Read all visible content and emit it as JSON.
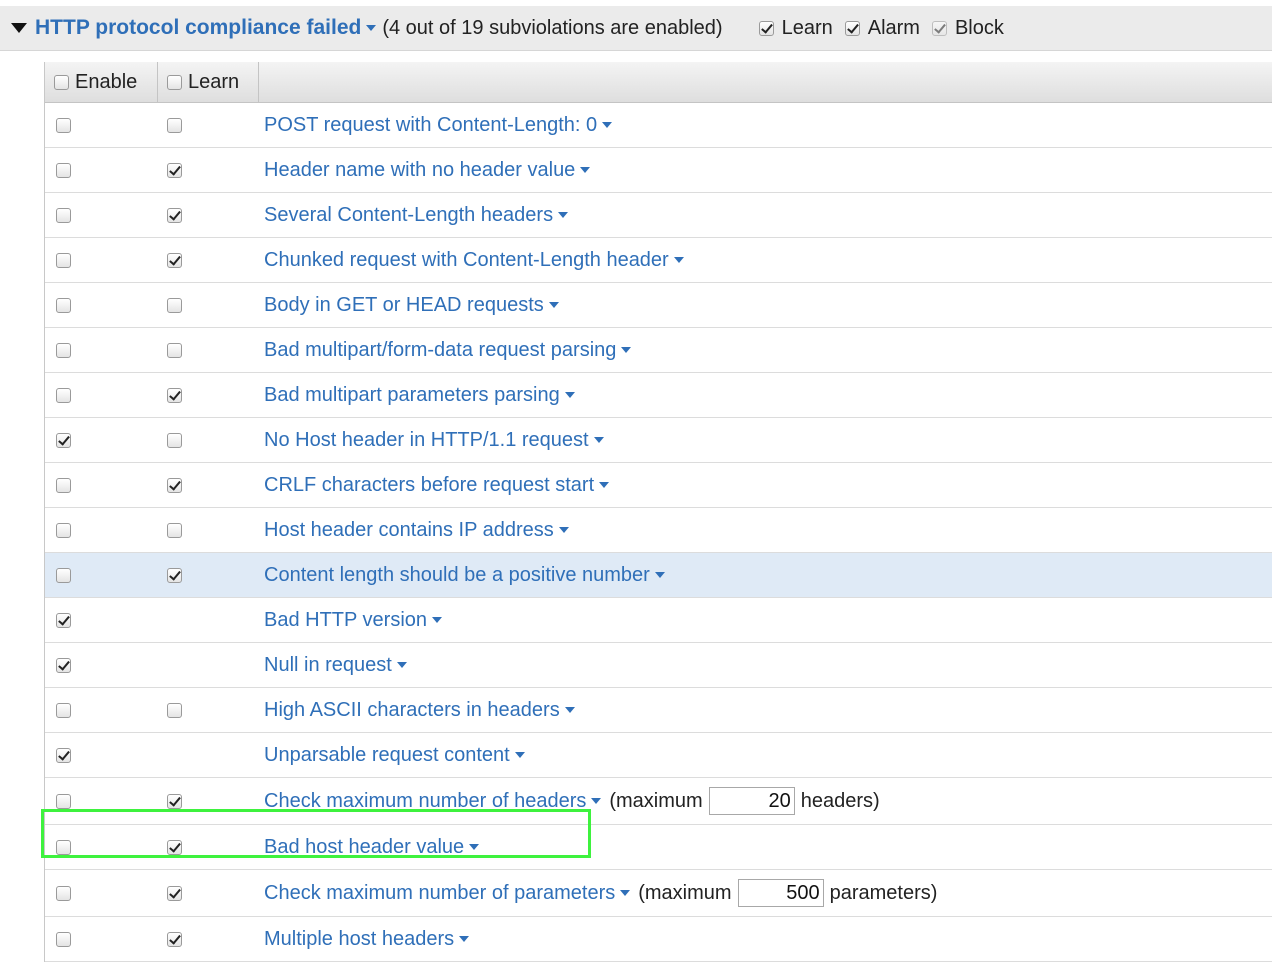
{
  "header": {
    "title": "HTTP protocol compliance failed",
    "summary": "(4 out of 19 subviolations are enabled)",
    "options": [
      {
        "label": "Learn",
        "checked": true,
        "disabled": false
      },
      {
        "label": "Alarm",
        "checked": true,
        "disabled": false
      },
      {
        "label": "Block",
        "checked": true,
        "disabled": true
      }
    ]
  },
  "table": {
    "columns": {
      "enable": "Enable",
      "learn": "Learn"
    },
    "rows": [
      {
        "name": "POST request with Content-Length: 0",
        "enable": false,
        "learn": false
      },
      {
        "name": "Header name with no header value",
        "enable": false,
        "learn": true
      },
      {
        "name": "Several Content-Length headers",
        "enable": false,
        "learn": true
      },
      {
        "name": "Chunked request with Content-Length header",
        "enable": false,
        "learn": true
      },
      {
        "name": "Body in GET or HEAD requests",
        "enable": false,
        "learn": false
      },
      {
        "name": "Bad multipart/form-data request parsing",
        "enable": false,
        "learn": false
      },
      {
        "name": "Bad multipart parameters parsing",
        "enable": false,
        "learn": true
      },
      {
        "name": "No Host header in HTTP/1.1 request",
        "enable": true,
        "learn": false
      },
      {
        "name": "CRLF characters before request start",
        "enable": false,
        "learn": true
      },
      {
        "name": "Host header contains IP address",
        "enable": false,
        "learn": false
      },
      {
        "name": "Content length should be a positive number",
        "enable": false,
        "learn": true,
        "highlighted": true
      },
      {
        "name": "Bad HTTP version",
        "enable": true,
        "learn": null
      },
      {
        "name": "Null in request",
        "enable": true,
        "learn": null
      },
      {
        "name": "High ASCII characters in headers",
        "enable": false,
        "learn": false
      },
      {
        "name": "Unparsable request content",
        "enable": true,
        "learn": null
      },
      {
        "name": "Check maximum number of headers",
        "enable": false,
        "learn": true,
        "prefix": "(maximum",
        "value": "20",
        "suffix": "headers)"
      },
      {
        "name": "Bad host header value",
        "enable": false,
        "learn": true
      },
      {
        "name": "Check maximum number of parameters",
        "enable": false,
        "learn": true,
        "prefix": "(maximum",
        "value": "500",
        "suffix": "parameters)"
      },
      {
        "name": "Multiple host headers",
        "enable": false,
        "learn": true
      }
    ]
  },
  "colors": {
    "link": "#2f6fb8",
    "header_bg": "#ebebeb",
    "row_highlight": "#dfeaf6",
    "annotation_box": "#3ef23e"
  }
}
